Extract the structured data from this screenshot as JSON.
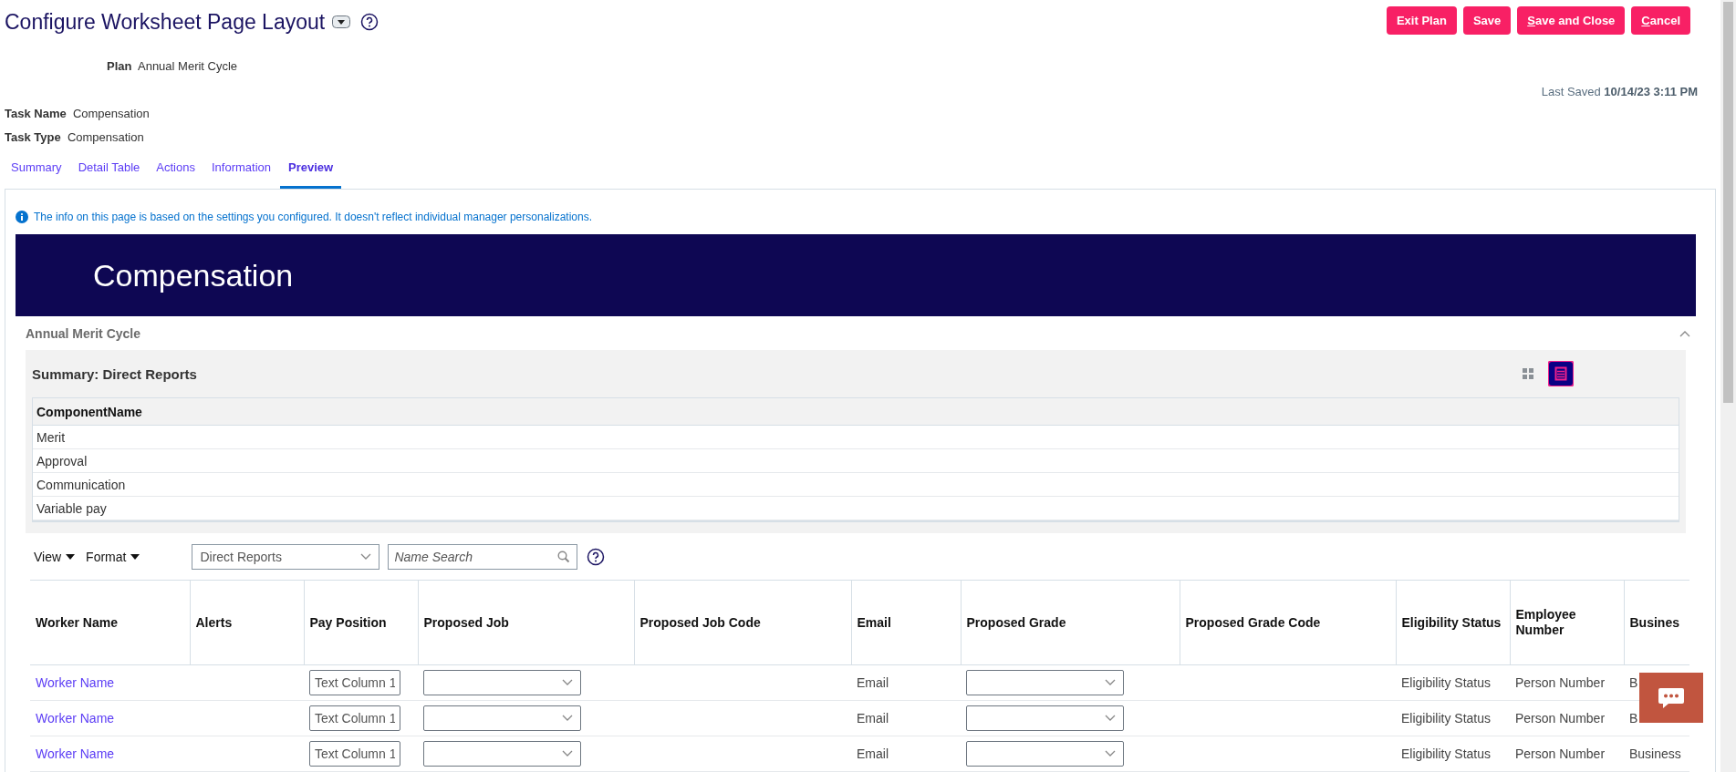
{
  "page": {
    "title": "Configure Worksheet Page Layout",
    "buttons": [
      {
        "label": "Exit Plan",
        "underline_first": false
      },
      {
        "label": "Save",
        "underline_first": false
      },
      {
        "label": "Save and Close",
        "underline_first": true
      },
      {
        "label": "Cancel",
        "underline_first": true
      }
    ],
    "plan": {
      "label": "Plan",
      "value": "Annual Merit Cycle"
    },
    "last_saved": {
      "label": "Last Saved",
      "value": "10/14/23 3:11 PM"
    },
    "fields": [
      {
        "label": "Task Name",
        "value": "Compensation"
      },
      {
        "label": "Task Type",
        "value": "Compensation"
      }
    ]
  },
  "tabs": [
    {
      "label": "Summary",
      "selected": false
    },
    {
      "label": "Detail Table",
      "selected": false
    },
    {
      "label": "Actions",
      "selected": false
    },
    {
      "label": "Information",
      "selected": false
    },
    {
      "label": "Preview",
      "selected": true
    }
  ],
  "preview": {
    "info": "The info on this page is based on the settings you configured. It doesn't reflect individual manager personalizations.",
    "banner": "Compensation",
    "section": {
      "title": "Annual Merit Cycle",
      "expanded": true
    },
    "summary": {
      "title": "Summary: Direct Reports",
      "views": [
        {
          "kind": "grid",
          "selected": false
        },
        {
          "kind": "list",
          "selected": true
        }
      ],
      "columns": [
        "ComponentName"
      ],
      "rows": [
        "Merit",
        "Approval",
        "Communication",
        "Variable pay"
      ]
    },
    "toolbar": {
      "menus": [
        "View",
        "Format"
      ],
      "filter": {
        "value": "Direct Reports"
      },
      "search": {
        "placeholder": "Name Search"
      }
    },
    "worker_table": {
      "columns": [
        "Worker Name",
        "Alerts",
        "Pay Position",
        "Proposed Job",
        "Proposed Job Code",
        "Email",
        "Proposed Grade",
        "Proposed Grade Code",
        "Eligibility Status",
        "Employee Number",
        "Busines"
      ],
      "rows": [
        {
          "cells": [
            {
              "kind": "link",
              "text": "Worker Name"
            },
            {
              "kind": "empty"
            },
            {
              "kind": "input",
              "value": "Text Column 1"
            },
            {
              "kind": "select"
            },
            {
              "kind": "empty"
            },
            {
              "kind": "text",
              "text": "Email"
            },
            {
              "kind": "select"
            },
            {
              "kind": "empty"
            },
            {
              "kind": "text",
              "text": "Eligibility Status"
            },
            {
              "kind": "text",
              "text": "Person Number"
            },
            {
              "kind": "text",
              "text": "B"
            }
          ]
        },
        {
          "cells": [
            {
              "kind": "link",
              "text": "Worker Name"
            },
            {
              "kind": "empty"
            },
            {
              "kind": "input",
              "value": "Text Column 1"
            },
            {
              "kind": "select"
            },
            {
              "kind": "empty"
            },
            {
              "kind": "text",
              "text": "Email"
            },
            {
              "kind": "select"
            },
            {
              "kind": "empty"
            },
            {
              "kind": "text",
              "text": "Eligibility Status"
            },
            {
              "kind": "text",
              "text": "Person Number"
            },
            {
              "kind": "text",
              "text": "B"
            }
          ]
        },
        {
          "cells": [
            {
              "kind": "link",
              "text": "Worker Name"
            },
            {
              "kind": "empty"
            },
            {
              "kind": "input",
              "value": "Text Column 1"
            },
            {
              "kind": "select"
            },
            {
              "kind": "empty"
            },
            {
              "kind": "text",
              "text": "Email"
            },
            {
              "kind": "select"
            },
            {
              "kind": "empty"
            },
            {
              "kind": "text",
              "text": "Eligibility Status"
            },
            {
              "kind": "text",
              "text": "Person Number"
            },
            {
              "kind": "text",
              "text": "Business"
            }
          ]
        }
      ]
    }
  }
}
